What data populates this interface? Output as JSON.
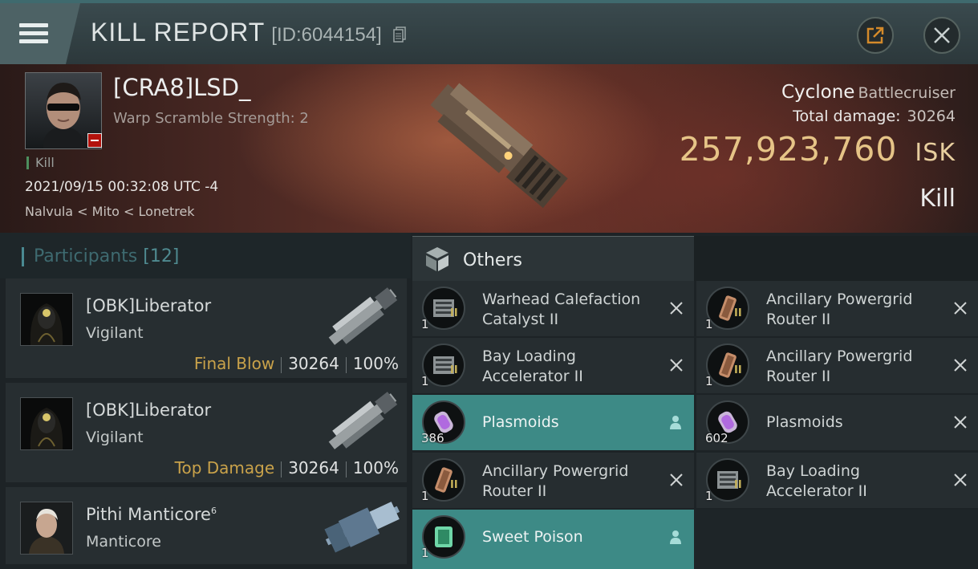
{
  "window": {
    "title": "KILL REPORT",
    "id_label": "[ID:6044154]"
  },
  "victim": {
    "name": "[CRA8]LSD_",
    "subtitle": "Warp Scramble Strength: 2",
    "tag": "Kill",
    "datetime": "2021/09/15 00:32:08 UTC -4",
    "location": "Nalvula < Mito < Lonetrek",
    "ship_name": "Cyclone",
    "ship_class": "Battlecruiser",
    "damage_label": "Total damage:",
    "damage_value": "30264",
    "isk_value": "257,923,760",
    "isk_unit": "ISK",
    "result": "Kill"
  },
  "participants": {
    "title": "Participants",
    "count": "[12]",
    "items": [
      {
        "name": "[OBK]Liberator",
        "ship": "Vigilant",
        "label": "Final Blow",
        "damage": "30264",
        "percent": "100%"
      },
      {
        "name": "[OBK]Liberator",
        "ship": "Vigilant",
        "label": "Top Damage",
        "damage": "30264",
        "percent": "100%"
      },
      {
        "name": "Pithi Manticore",
        "superscript": "6",
        "ship": "Manticore"
      }
    ]
  },
  "others": {
    "title": "Others",
    "left": [
      {
        "name": "Warhead Calefaction Catalyst II",
        "qty": "1",
        "meta": "II",
        "state": "destroyed"
      },
      {
        "name": "Bay Loading Accelerator II",
        "qty": "1",
        "meta": "II",
        "state": "destroyed"
      },
      {
        "name": "Plasmoids",
        "qty": "386",
        "meta": "",
        "state": "dropped"
      },
      {
        "name": "Ancillary Powergrid Router II",
        "qty": "1",
        "meta": "II",
        "state": "destroyed"
      },
      {
        "name": "Sweet Poison",
        "qty": "1",
        "meta": "",
        "state": "dropped"
      }
    ],
    "right": [
      {
        "name": "Ancillary Powergrid Router II",
        "qty": "1",
        "meta": "II",
        "state": "destroyed"
      },
      {
        "name": "Ancillary Powergrid Router II",
        "qty": "1",
        "meta": "II",
        "state": "destroyed"
      },
      {
        "name": "Plasmoids",
        "qty": "602",
        "meta": "",
        "state": "destroyed"
      },
      {
        "name": "Bay Loading Accelerator II",
        "qty": "1",
        "meta": "II",
        "state": "destroyed"
      }
    ]
  },
  "colors": {
    "isk": "#e6c487",
    "dropped_highlight": "#3d8a86",
    "accent_teal": "#4a8a92",
    "label_gold": "#c9a24a"
  }
}
